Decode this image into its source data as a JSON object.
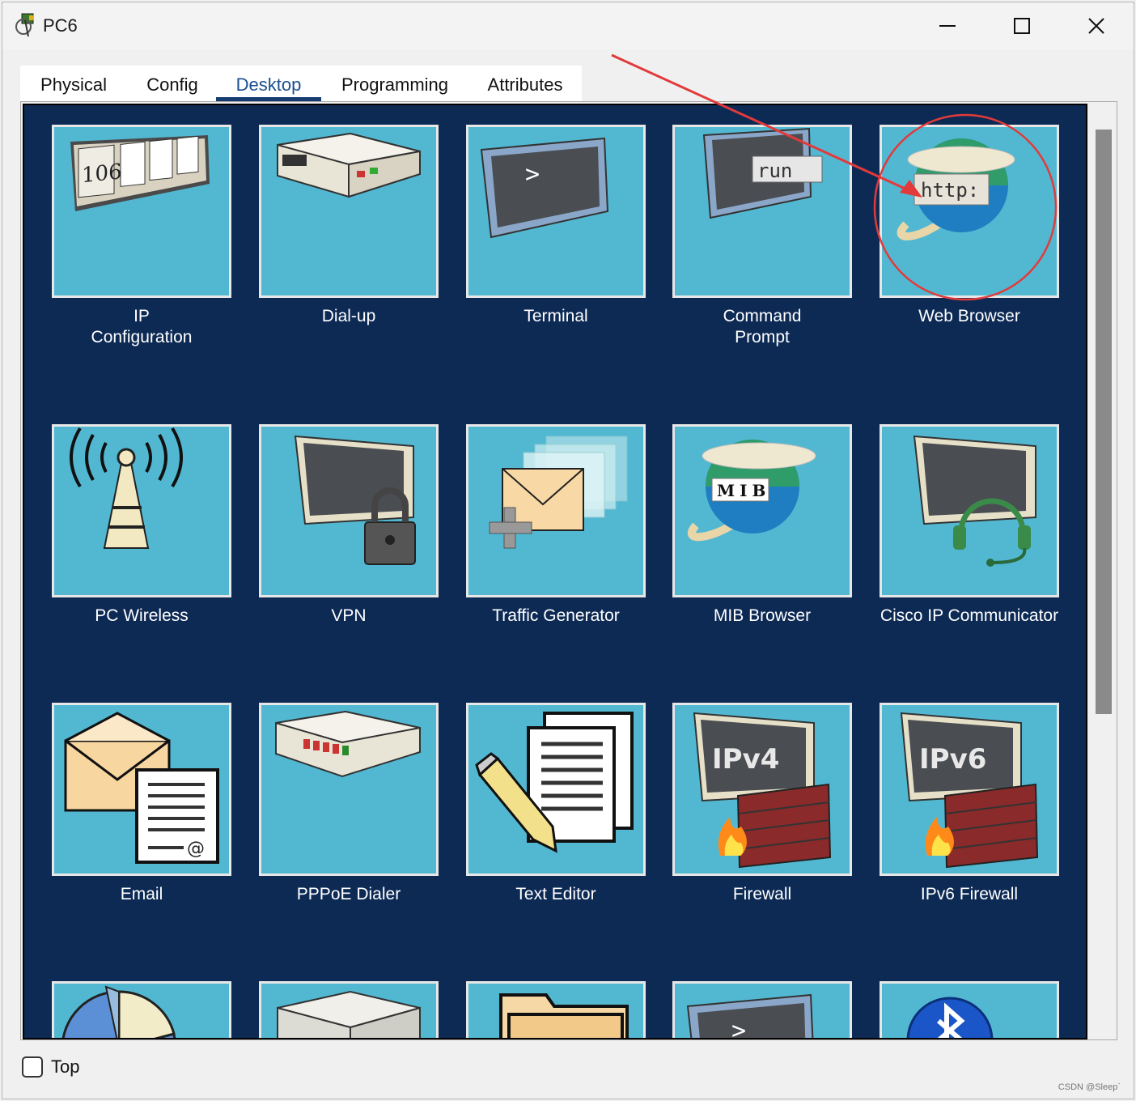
{
  "window": {
    "title": "PC6"
  },
  "tabs": [
    {
      "label": "Physical",
      "active": false
    },
    {
      "label": "Config",
      "active": false
    },
    {
      "label": "Desktop",
      "active": true
    },
    {
      "label": "Programming",
      "active": false
    },
    {
      "label": "Attributes",
      "active": false
    }
  ],
  "apps": [
    {
      "label": "IP\nConfiguration",
      "icon": "ip-configuration-icon",
      "icon_text": "106"
    },
    {
      "label": "Dial-up",
      "icon": "dialup-modem-icon"
    },
    {
      "label": "Terminal",
      "icon": "terminal-icon",
      "icon_text": ">"
    },
    {
      "label": "Command\nPrompt",
      "icon": "command-prompt-icon",
      "icon_text": "run"
    },
    {
      "label": "Web Browser",
      "icon": "web-browser-icon",
      "icon_text": "http:"
    },
    {
      "label": "PC Wireless",
      "icon": "wireless-tower-icon"
    },
    {
      "label": "VPN",
      "icon": "vpn-lock-icon"
    },
    {
      "label": "Traffic Generator",
      "icon": "traffic-generator-icon"
    },
    {
      "label": "MIB Browser",
      "icon": "mib-browser-icon",
      "icon_text": "MIB"
    },
    {
      "label": "Cisco IP Communicator",
      "icon": "ip-communicator-headset-icon"
    },
    {
      "label": "Email",
      "icon": "email-icon",
      "icon_text": "@"
    },
    {
      "label": "PPPoE Dialer",
      "icon": "pppoe-dialer-icon"
    },
    {
      "label": "Text Editor",
      "icon": "text-editor-icon"
    },
    {
      "label": "Firewall",
      "icon": "ipv4-firewall-icon",
      "icon_text": "IPv4"
    },
    {
      "label": "IPv6 Firewall",
      "icon": "ipv6-firewall-icon",
      "icon_text": "IPv6"
    },
    {
      "label": "",
      "icon": "pie-chart-icon"
    },
    {
      "label": "",
      "icon": "box-device-icon"
    },
    {
      "label": "",
      "icon": "folder-icon"
    },
    {
      "label": "",
      "icon": "terminal-icon",
      "icon_text": ">"
    },
    {
      "label": "",
      "icon": "bluetooth-icon"
    }
  ],
  "footer": {
    "top_checkbox_label": "Top",
    "top_checked": false
  },
  "watermark": "CSDN @Sleep`",
  "colors": {
    "desktop_bg": "#0d2a55",
    "tile_bg": "#52b8d2",
    "annotation": "#e23a3a"
  }
}
